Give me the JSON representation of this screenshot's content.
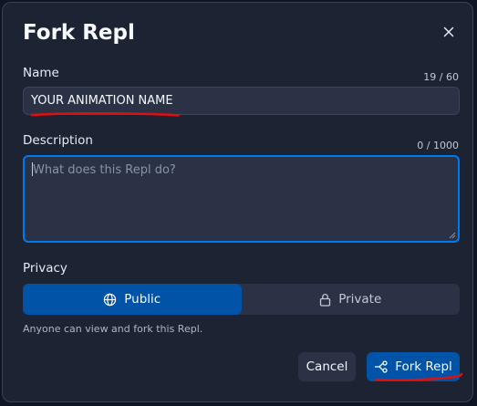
{
  "dialog": {
    "title": "Fork Repl",
    "close_icon": "close-icon"
  },
  "name_field": {
    "label": "Name",
    "counter": "19 / 60",
    "value": "YOUR ANIMATION NAME"
  },
  "description_field": {
    "label": "Description",
    "counter": "0 / 1000",
    "value": "",
    "placeholder": "What does this Repl do?"
  },
  "privacy": {
    "label": "Privacy",
    "options": [
      {
        "label": "Public",
        "icon": "globe-icon",
        "selected": true
      },
      {
        "label": "Private",
        "icon": "lock-icon",
        "selected": false
      }
    ],
    "helper_text": "Anyone can view and fork this Repl."
  },
  "actions": {
    "cancel_label": "Cancel",
    "fork_label": "Fork Repl",
    "fork_icon": "fork-icon"
  },
  "annotation": {
    "color": "#e01010"
  },
  "colors": {
    "background": "#1c2333",
    "accent": "#0079f2",
    "primary_button": "#0053a6"
  }
}
